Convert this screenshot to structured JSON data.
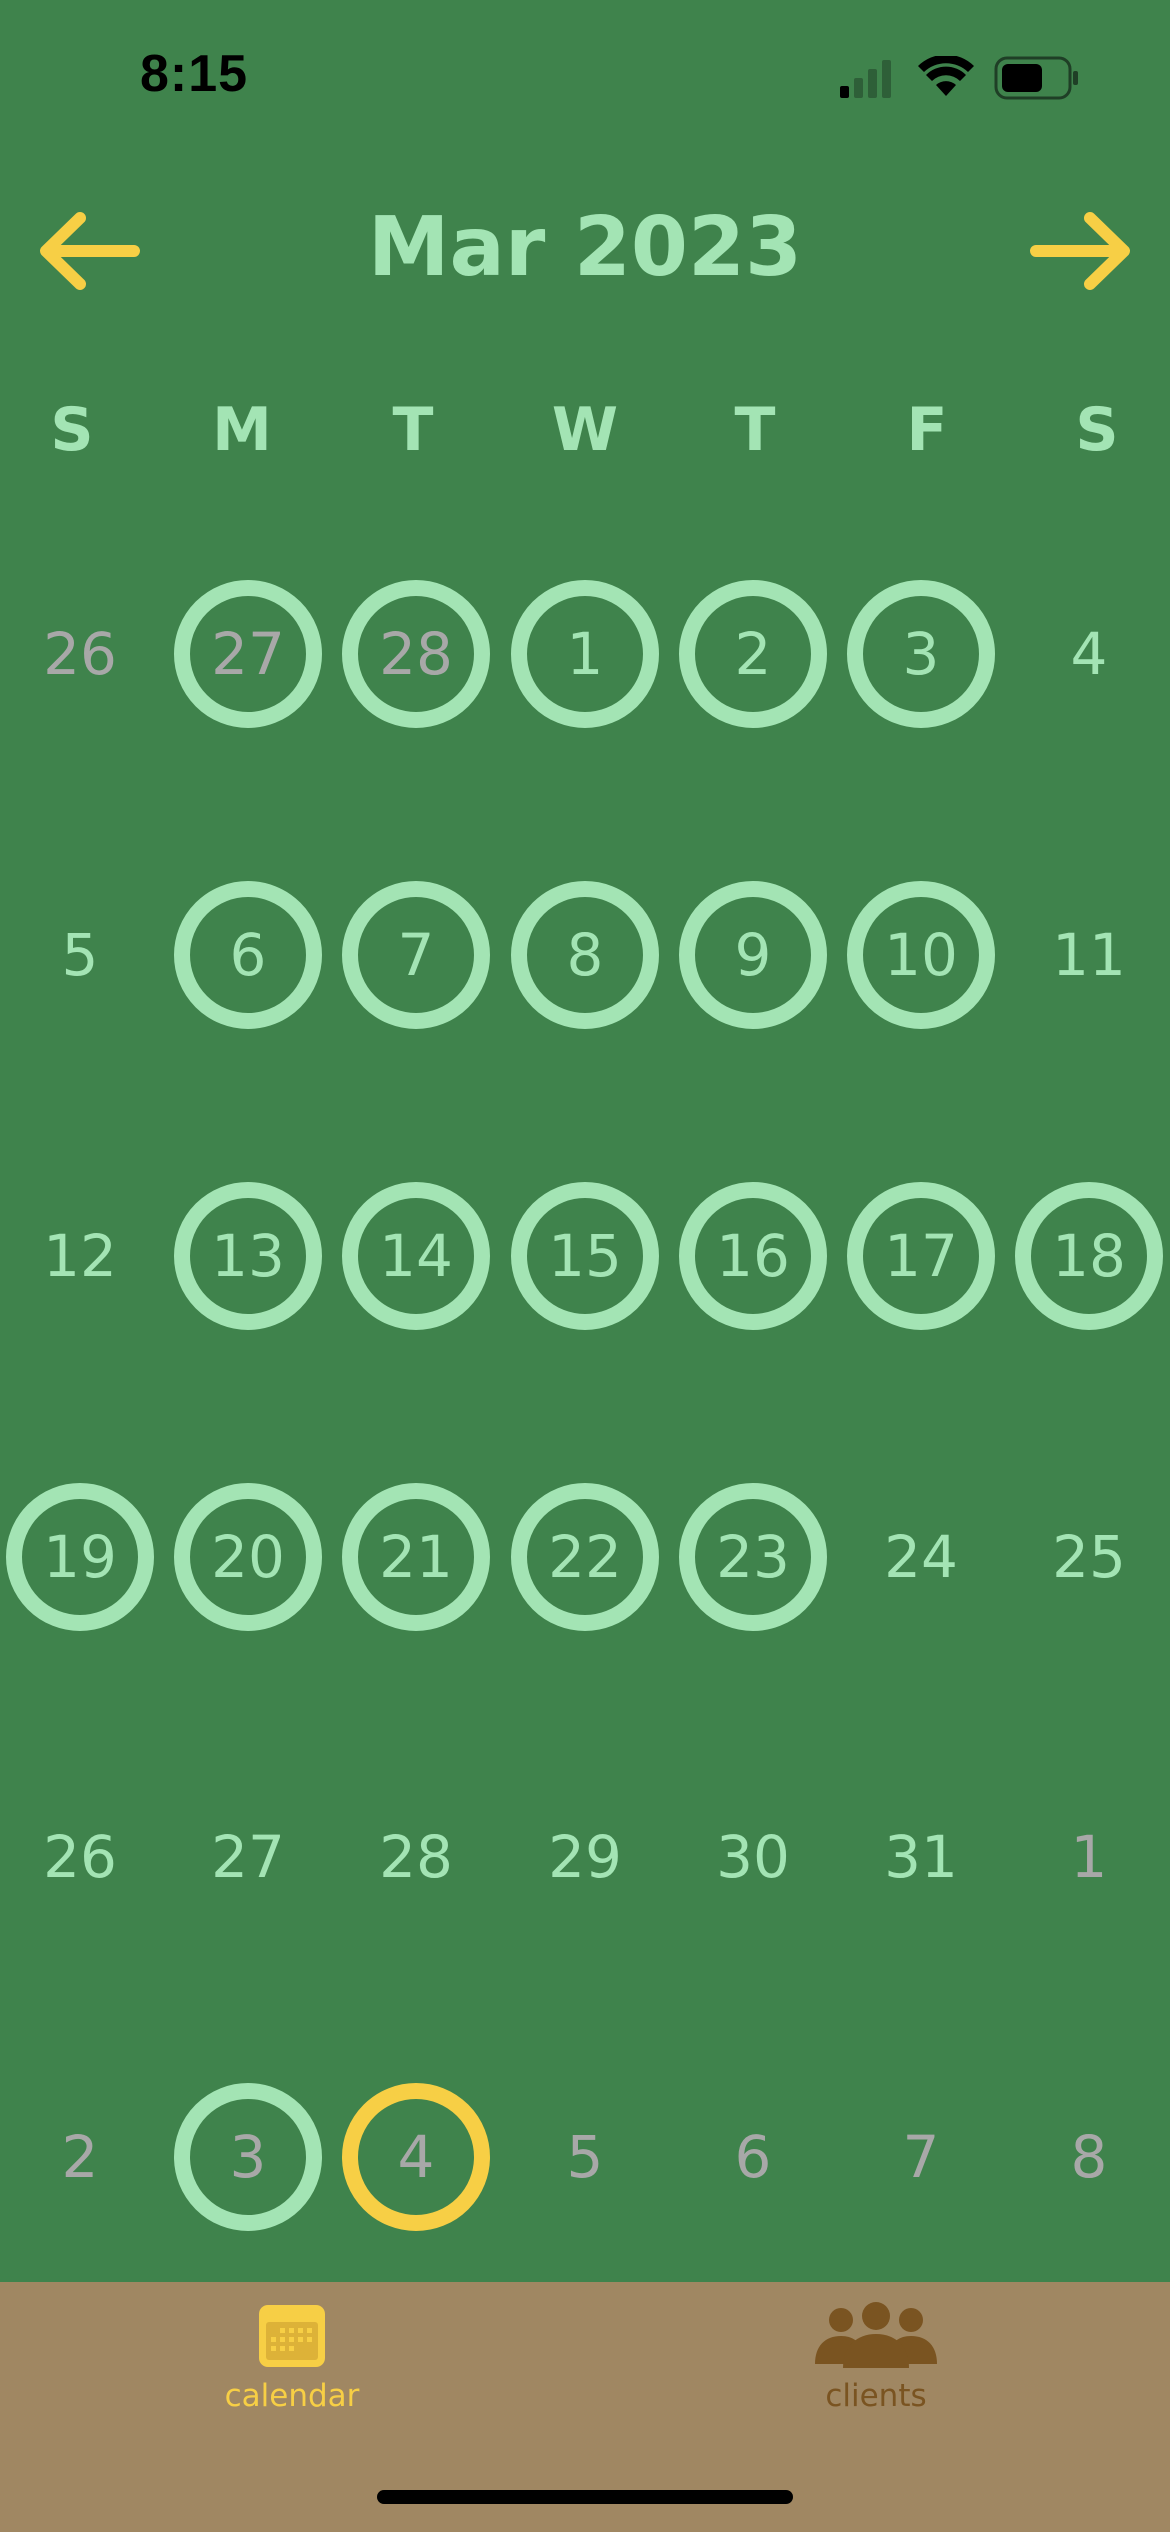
{
  "status_bar": {
    "time": "8:15"
  },
  "header": {
    "month_title": "Mar 2023",
    "prev_icon": "arrow-left-icon",
    "next_icon": "arrow-right-icon"
  },
  "weekdays": [
    "S",
    "M",
    "T",
    "W",
    "T",
    "F",
    "S"
  ],
  "weeks": [
    [
      {
        "label": "26",
        "state": "plain",
        "muted": true
      },
      {
        "label": "27",
        "state": "ring",
        "muted": true
      },
      {
        "label": "28",
        "state": "ring",
        "muted": true
      },
      {
        "label": "1",
        "state": "ring",
        "muted": false
      },
      {
        "label": "2",
        "state": "ring",
        "muted": false
      },
      {
        "label": "3",
        "state": "ring",
        "muted": false
      },
      {
        "label": "4",
        "state": "plain",
        "muted": false
      }
    ],
    [
      {
        "label": "5",
        "state": "plain",
        "muted": false
      },
      {
        "label": "6",
        "state": "ring",
        "muted": false
      },
      {
        "label": "7",
        "state": "ring",
        "muted": false
      },
      {
        "label": "8",
        "state": "ring",
        "muted": false
      },
      {
        "label": "9",
        "state": "ring",
        "muted": false
      },
      {
        "label": "10",
        "state": "ring",
        "muted": false
      },
      {
        "label": "11",
        "state": "plain",
        "muted": false
      }
    ],
    [
      {
        "label": "12",
        "state": "plain",
        "muted": false
      },
      {
        "label": "13",
        "state": "ring",
        "muted": false
      },
      {
        "label": "14",
        "state": "ring",
        "muted": false
      },
      {
        "label": "15",
        "state": "ring",
        "muted": false
      },
      {
        "label": "16",
        "state": "ring",
        "muted": false
      },
      {
        "label": "17",
        "state": "ring",
        "muted": false
      },
      {
        "label": "18",
        "state": "ring",
        "muted": false
      }
    ],
    [
      {
        "label": "19",
        "state": "ring",
        "muted": false
      },
      {
        "label": "20",
        "state": "ring",
        "muted": false
      },
      {
        "label": "21",
        "state": "ring",
        "muted": false
      },
      {
        "label": "22",
        "state": "ring",
        "muted": false
      },
      {
        "label": "23",
        "state": "ring",
        "muted": false
      },
      {
        "label": "24",
        "state": "plain",
        "muted": false
      },
      {
        "label": "25",
        "state": "plain",
        "muted": false
      }
    ],
    [
      {
        "label": "26",
        "state": "plain",
        "muted": false
      },
      {
        "label": "27",
        "state": "plain",
        "muted": false
      },
      {
        "label": "28",
        "state": "plain",
        "muted": false
      },
      {
        "label": "29",
        "state": "plain",
        "muted": false
      },
      {
        "label": "30",
        "state": "plain",
        "muted": false
      },
      {
        "label": "31",
        "state": "plain",
        "muted": false
      },
      {
        "label": "1",
        "state": "plain",
        "muted": true
      }
    ],
    [
      {
        "label": "2",
        "state": "plain",
        "muted": true
      },
      {
        "label": "3",
        "state": "ring",
        "muted": true
      },
      {
        "label": "4",
        "state": "today",
        "muted": true
      },
      {
        "label": "5",
        "state": "plain",
        "muted": true
      },
      {
        "label": "6",
        "state": "plain",
        "muted": true
      },
      {
        "label": "7",
        "state": "plain",
        "muted": true
      },
      {
        "label": "8",
        "state": "plain",
        "muted": true
      }
    ]
  ],
  "tab_bar": {
    "tabs": [
      {
        "label": "calendar",
        "icon": "calendar-icon",
        "active": true
      },
      {
        "label": "clients",
        "icon": "people-icon",
        "active": false
      }
    ]
  },
  "colors": {
    "background": "#3F834C",
    "accent_light_green": "#A3E4B4",
    "accent_yellow": "#F7CF45",
    "muted_text": "#A8A8A8",
    "tab_bar_bg": "#A08762",
    "tab_inactive": "#7A5421"
  }
}
